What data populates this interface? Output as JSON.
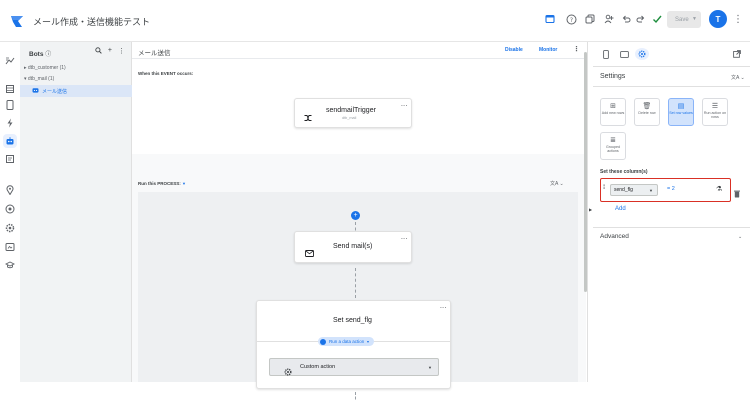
{
  "app": {
    "title": "メール作成・送信機能テスト",
    "save_label": "Save",
    "avatar_initial": "T"
  },
  "colors": {
    "accent": "#1a73e8",
    "highlight": "#d93025",
    "selected_bg": "#dbe6f7"
  },
  "tree": {
    "heading": "Bots",
    "items": [
      {
        "label": "▸ dtb_customer (1)"
      },
      {
        "label": "▾ dtb_mail (1)"
      },
      {
        "label": "メール送信"
      }
    ]
  },
  "canvas": {
    "title": "メール送信",
    "disable_label": "Disable",
    "monitor_label": "Monitor",
    "event_label": "When this EVENT occurs:",
    "trigger": {
      "title": "sendmailTrigger",
      "subtitle": "dtb_mail"
    },
    "process_label": "Run this PROCESS:",
    "step1": {
      "title": "Send mail(s)"
    },
    "step2": {
      "title": "Set send_flg",
      "pill_label": "Run a data action",
      "action_label": "Custom action"
    }
  },
  "settings": {
    "title": "Settings",
    "options": [
      {
        "label": "Add new rows"
      },
      {
        "label": "Delete row"
      },
      {
        "label": "Set row values"
      },
      {
        "label": "Run action on rows"
      },
      {
        "label": "Grouped actions"
      }
    ],
    "columns_label": "Set these column(s)",
    "column": {
      "name": "send_flg",
      "value": "= 2"
    },
    "add_label": "Add",
    "advanced_label": "Advanced"
  }
}
